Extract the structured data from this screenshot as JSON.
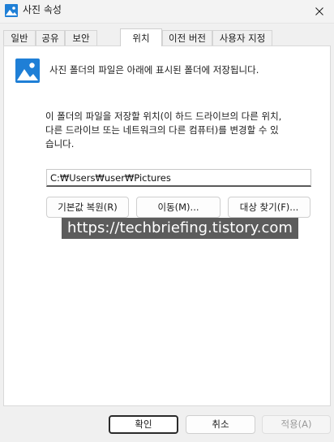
{
  "window": {
    "title": "사진 속성"
  },
  "tabs": [
    {
      "label": "일반"
    },
    {
      "label": "공유"
    },
    {
      "label": "보안"
    },
    {
      "label": "위치"
    },
    {
      "label": "이전 버전"
    },
    {
      "label": "사용자 지정"
    }
  ],
  "active_tab": "위치",
  "location": {
    "info": "사진 폴더의 파일은 아래에 표시된 폴더에 저장됩니다.",
    "description_line1": "이 폴더의 파일을 저장할 위치(이 하드 드라이브의 다른 위치,",
    "description_line2": "다른 드라이브 또는 네트워크의 다른 컴퓨터)를 변경할 수 있",
    "description_line3": "습니다.",
    "path_value": "C:₩Users₩user₩Pictures",
    "restore_label": "기본값 복원(R)",
    "move_label": "이동(M)...",
    "find_target_label": "대상 찾기(F)..."
  },
  "watermark": {
    "text": "https://techbriefing.tistory.com"
  },
  "footer": {
    "ok_label": "확인",
    "cancel_label": "취소",
    "apply_label": "적용(A)"
  },
  "colors": {
    "photo_icon_blue": "#1f7fd6",
    "accent_border": "#2b2b2b",
    "disabled_text": "#9a9a9a"
  },
  "icons": {
    "title": "photo-icon",
    "close": "close-icon",
    "folder": "photo-icon"
  }
}
